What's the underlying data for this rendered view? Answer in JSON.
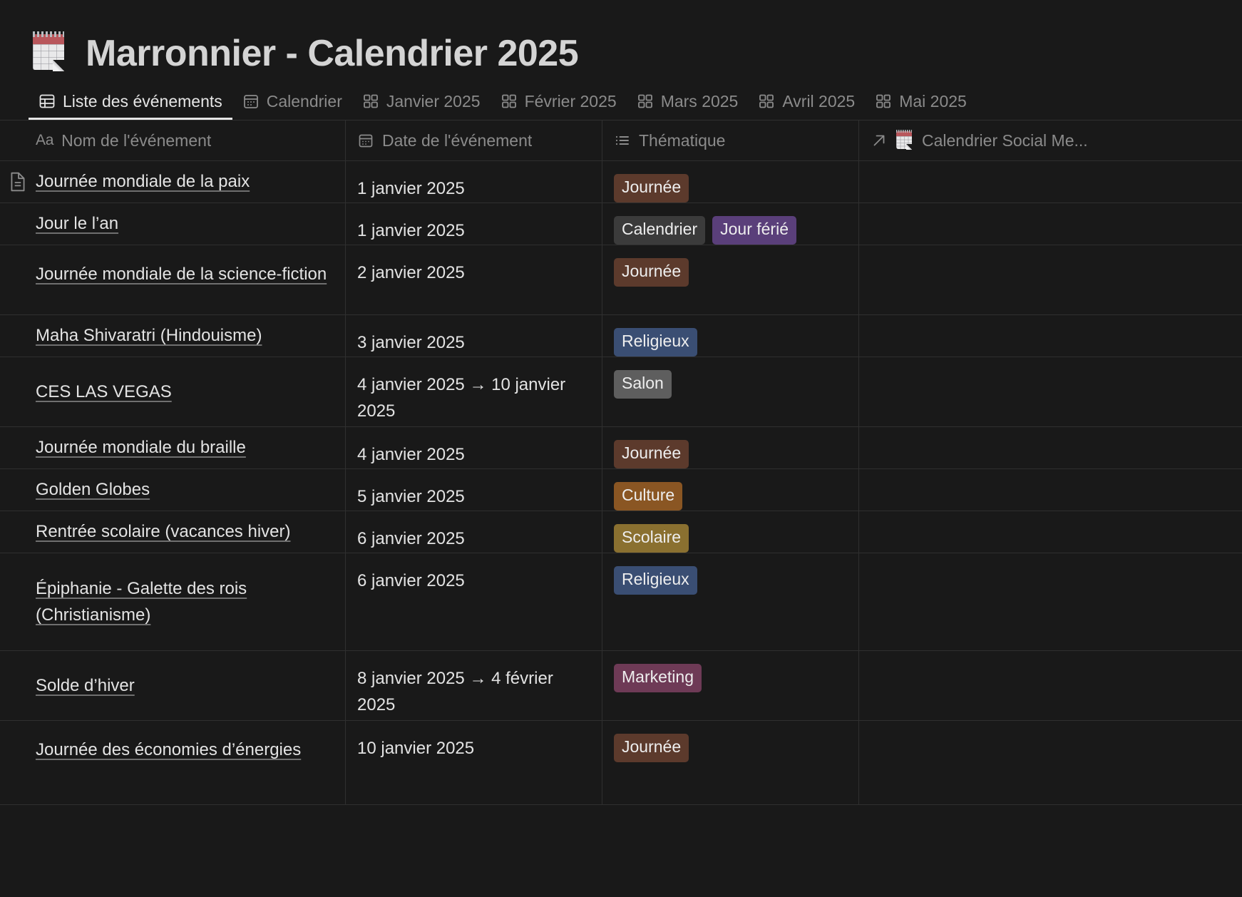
{
  "header": {
    "emoji": "calendar-emoji",
    "title": "Marronnier - Calendrier 2025"
  },
  "tabs": [
    {
      "label": "Liste des événements",
      "icon": "table-view-icon",
      "active": true
    },
    {
      "label": "Calendrier",
      "icon": "calendar-view-icon",
      "active": false
    },
    {
      "label": "Janvier 2025",
      "icon": "board-view-icon",
      "active": false
    },
    {
      "label": "Février 2025",
      "icon": "board-view-icon",
      "active": false
    },
    {
      "label": "Mars 2025",
      "icon": "board-view-icon",
      "active": false
    },
    {
      "label": "Avril 2025",
      "icon": "board-view-icon",
      "active": false
    },
    {
      "label": "Mai 2025",
      "icon": "board-view-icon",
      "active": false
    }
  ],
  "table": {
    "columns": [
      {
        "label": "Nom de l'événement",
        "icon": "title-aa-icon",
        "prefix": "Aa"
      },
      {
        "label": "Date de l'événement",
        "icon": "date-icon"
      },
      {
        "label": "Thématique",
        "icon": "multi-select-icon"
      },
      {
        "label": "Calendrier Social Me...",
        "icon": "relation-arrow-icon",
        "emoji": "calendar-emoji"
      }
    ],
    "tag_colors": {
      "Journée": "#5c3a2c",
      "Calendrier": "#3b3b3b",
      "Jour férié": "#5a3f7a",
      "Religieux": "#3a4e73",
      "Salon": "#5e5e5e",
      "Culture": "#8a5623",
      "Scolaire": "#8a7030",
      "Marketing": "#6e3a56"
    },
    "rows": [
      {
        "name": "Journée mondiale de la paix",
        "date": "1 janvier 2025",
        "tags": [
          "Journée"
        ],
        "relation": "",
        "has_doc_icon": true,
        "height": "h1"
      },
      {
        "name": "Jour le l’an",
        "date": "1 janvier 2025",
        "tags": [
          "Calendrier",
          "Jour férié"
        ],
        "relation": "",
        "has_doc_icon": false,
        "height": "h1"
      },
      {
        "name": "Journée mondiale de la science-fiction",
        "date": "2 janvier 2025",
        "tags": [
          "Journée"
        ],
        "relation": "",
        "has_doc_icon": false,
        "height": "h2",
        "name_top": true
      },
      {
        "name": "Maha Shivaratri (Hindouisme)",
        "date": "3 janvier 2025",
        "tags": [
          "Religieux"
        ],
        "relation": "",
        "has_doc_icon": false,
        "height": "h1"
      },
      {
        "name": "CES LAS VEGAS",
        "date": "4 janvier 2025 → 10 janvier 2025",
        "tags": [
          "Salon"
        ],
        "relation": "",
        "has_doc_icon": false,
        "height": "h2"
      },
      {
        "name": "Journée mondiale du braille",
        "date": "4 janvier 2025",
        "tags": [
          "Journée"
        ],
        "relation": "",
        "has_doc_icon": false,
        "height": "h1"
      },
      {
        "name": "Golden Globes",
        "date": "5 janvier 2025",
        "tags": [
          "Culture"
        ],
        "relation": "",
        "has_doc_icon": false,
        "height": "h1"
      },
      {
        "name": "Rentrée scolaire (vacances hiver)",
        "date": "6 janvier 2025",
        "tags": [
          "Scolaire"
        ],
        "relation": "",
        "has_doc_icon": false,
        "height": "h1"
      },
      {
        "name": "Épiphanie - Galette des rois (Christianisme)",
        "date": "6 janvier 2025",
        "tags": [
          "Religieux"
        ],
        "relation": "",
        "has_doc_icon": false,
        "height": "h4"
      },
      {
        "name": "Solde d’hiver",
        "date": "8 janvier 2025 → 4 février 2025",
        "tags": [
          "Marketing"
        ],
        "relation": "",
        "has_doc_icon": false,
        "height": "h2"
      },
      {
        "name": "Journée des économies d’énergies",
        "date": "10 janvier 2025",
        "tags": [
          "Journée"
        ],
        "relation": "",
        "has_doc_icon": false,
        "height": "h3",
        "name_top": true
      }
    ]
  }
}
